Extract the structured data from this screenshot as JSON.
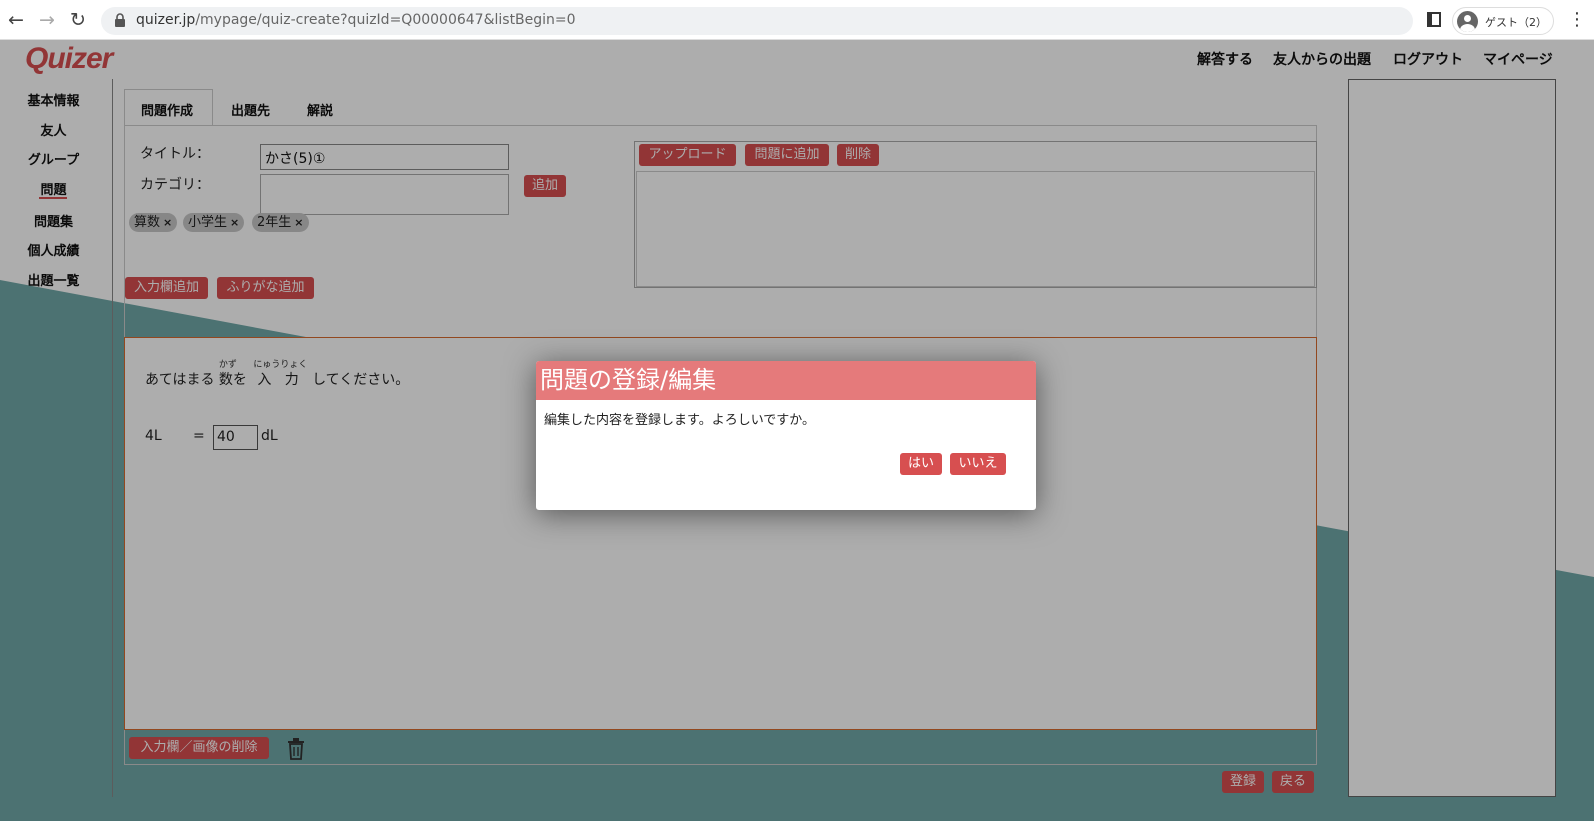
{
  "browser": {
    "url_host": "quizer.jp",
    "url_path": "/mypage/quiz-create?quizId=Q00000647&listBegin=0",
    "profile_label": "ゲスト（2）"
  },
  "app": {
    "logo": "Quizer",
    "topnav": [
      "解答する",
      "友人からの出題",
      "ログアウト",
      "マイページ"
    ],
    "sidebar": [
      "基本情報",
      "友人",
      "グループ",
      "問題",
      "問題集",
      "個人成績",
      "出題一覧"
    ],
    "active_sidebar": "問題",
    "accent_color": "#d74f50"
  },
  "tabs": [
    "問題作成",
    "出題先",
    "解説"
  ],
  "form": {
    "title_label": "タイトル：",
    "title_value": "かさ(5)①",
    "category_label": "カテゴリ：",
    "category_value": "",
    "add_button": "追加",
    "tags": [
      "算数",
      "小学生",
      "2年生"
    ],
    "tag_remove": "×",
    "add_input_button": "入力欄追加",
    "add_furigana_button": "ふりがな追加"
  },
  "image_panel": {
    "upload_button": "アップロード",
    "add_to_question_button": "問題に追加",
    "delete_button": "削除"
  },
  "question": {
    "text_before": "あてはまる",
    "kazu": {
      "base": "数",
      "ruby": "かず"
    },
    "text_wo": "を",
    "nyuuryoku": {
      "base1": "入",
      "base2": "力",
      "ruby": "にゅうりょく"
    },
    "text_after": "してください。",
    "lhs": "4L",
    "equals": "=",
    "answer_value": "40",
    "unit": "dL"
  },
  "bottom": {
    "delete_input_image_button": "入力欄／画像の削除",
    "register_button": "登録",
    "back_button": "戻る"
  },
  "modal": {
    "title": "問題の登録/編集",
    "message": "編集した内容を登録します。よろしいですか。",
    "yes_button": "はい",
    "no_button": "いいえ"
  }
}
